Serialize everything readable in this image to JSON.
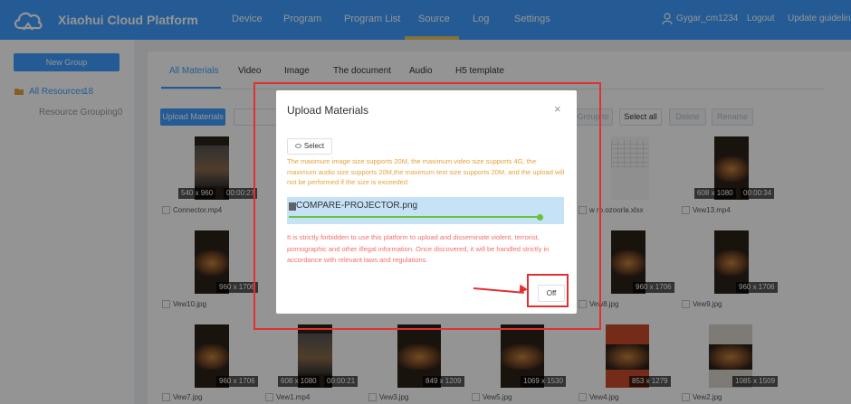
{
  "header": {
    "brand": "Xiaohui Cloud Platform",
    "nav": [
      "Device",
      "Program",
      "Program List",
      "Source",
      "Log",
      "Settings"
    ],
    "active_nav": "Source",
    "user": "Gygar_cm1234",
    "logout": "Logout",
    "update": "Update guidelines"
  },
  "sidebar": {
    "new_group": "New Group",
    "all_resources": "All Resources",
    "all_resources_count": "18",
    "resource_grouping": "Resource Grouping0"
  },
  "tabs": [
    "All Materials",
    "Video",
    "Image",
    "The document",
    "Audio",
    "H5 template"
  ],
  "toolbar": {
    "upload": "Upload Materials",
    "group_partial": "Group to",
    "select_all": "Select all",
    "delete": "Delete",
    "rename": "Rename"
  },
  "files": [
    {
      "name": "Connector.mp4",
      "size": "540 x 960",
      "duration": "00:00:27"
    },
    {
      "name": "w ro.ozoorla.xlsx",
      "size": "",
      "duration": ""
    },
    {
      "name": "Vew13.mp4",
      "size": "608 x 1080",
      "duration": "00:00:34"
    },
    {
      "name": "Vew10.jpg",
      "size": "960 x 1706",
      "duration": ""
    },
    {
      "name": "Vew8.jpg",
      "size": "960 x 1706",
      "duration": ""
    },
    {
      "name": "Vew9.jpg",
      "size": "960 x 1706",
      "duration": ""
    },
    {
      "name": "Vew7.jpg",
      "size": "960 x 1706",
      "duration": ""
    },
    {
      "name": "Vew1.mp4",
      "size": "608 x 1080",
      "duration": "00:00:21"
    },
    {
      "name": "Vew3.jpg",
      "size": "849 x 1209",
      "duration": ""
    },
    {
      "name": "Vew5.jpg",
      "size": "1069 x 1530",
      "duration": ""
    },
    {
      "name": "Vew4.jpg",
      "size": "853 x 1279",
      "duration": ""
    },
    {
      "name": "Vew2.jpg",
      "size": "1085 x 1509",
      "duration": ""
    }
  ],
  "dialog": {
    "title": "Upload Materials",
    "close": "×",
    "select": "Select",
    "warning": "The maximum image size supports 20M, the maximum video size supports 4G, the maximum audio size supports 20M,the maximum text size supports 20M, and the upload will not be performed if the size is exceeded",
    "file_name": "COMPARE-PROJECTOR.png",
    "upload_progress": 1.0,
    "forbid": "It is strictly forbidden to use this platform to upload and disseminate violent, terrorist, pornographic and other illegal information. Once discovered, it will be handled strictly in accordance with relevant laws and regulations.",
    "off": "Off"
  },
  "colors": {
    "primary": "#409eff",
    "warning": "#e6a23c",
    "danger": "#f56c6c",
    "success": "#67c23a",
    "annotation": "#e03030"
  }
}
